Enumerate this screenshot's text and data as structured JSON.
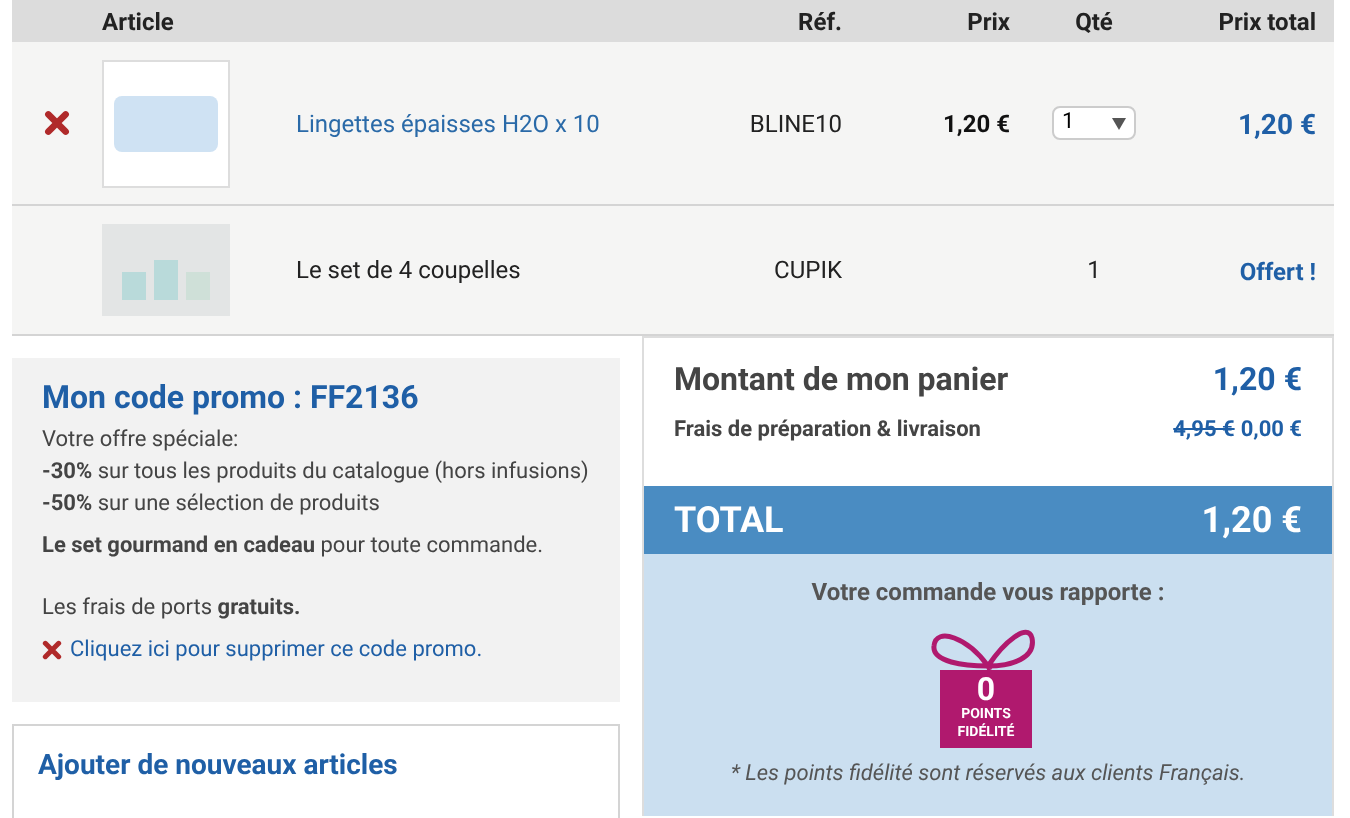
{
  "table": {
    "columns": [
      "Article",
      "Réf.",
      "Prix",
      "Qté",
      "Prix total"
    ],
    "rows": [
      {
        "removable": true,
        "name": "Lingettes épaisses H2O x 10",
        "link": true,
        "ref": "BLINE10",
        "price": "1,20 €",
        "kind": "select",
        "qty": "1",
        "total": "1,20 €"
      },
      {
        "removable": false,
        "name": "Le set de 4 coupelles",
        "link": false,
        "ref": "CUPIK",
        "price": "",
        "kind": "text",
        "qty": "1",
        "total": "Offert !"
      }
    ]
  },
  "promo": {
    "title": "Mon code promo : FF2136",
    "lines": [
      "Votre offre spéciale:",
      "**-30%** sur tous les produits du catalogue (hors infusions)",
      "**-50%** sur une sélection de produits"
    ],
    "gift": "**Le set gourmand en cadeau** pour toute commande.",
    "shipping": "Les frais de ports **gratuits.**",
    "remove_link": "Cliquez ici pour supprimer ce code promo."
  },
  "add_articles": {
    "title": "Ajouter de nouveaux articles"
  },
  "summary": {
    "subtotal_label": "Montant de mon panier",
    "subtotal": "1,20 €",
    "shipping_label": "Frais de préparation & livraison",
    "shipping_old": "4,95 €",
    "shipping_new": "0,00 €",
    "total_label": "TOTAL",
    "total": "1,20 €",
    "points_title": "Votre commande vous rapporte :",
    "points": "0",
    "points_label_1": "POINTS",
    "points_label_2": "FIDÉLITÉ",
    "points_note": "* Les points fidélité sont réservés aux clients Français."
  }
}
